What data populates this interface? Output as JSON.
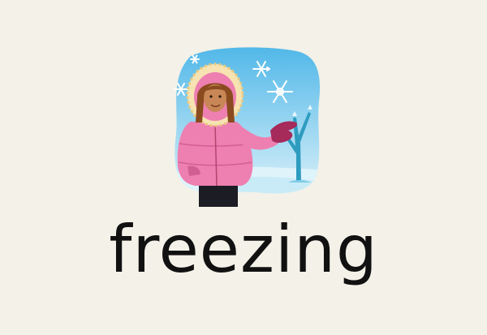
{
  "card": {
    "word": "freezing",
    "illustration_icon": "girl-in-winter-coat-snow-icon"
  },
  "colors": {
    "background": "#f3f1e8",
    "sky_top": "#4fb7e8",
    "sky_bottom": "#d9f1fb",
    "coat": "#ee7fb1",
    "mitten": "#a62a5a",
    "ice_tree": "#2e9cc0",
    "text": "#111111"
  }
}
